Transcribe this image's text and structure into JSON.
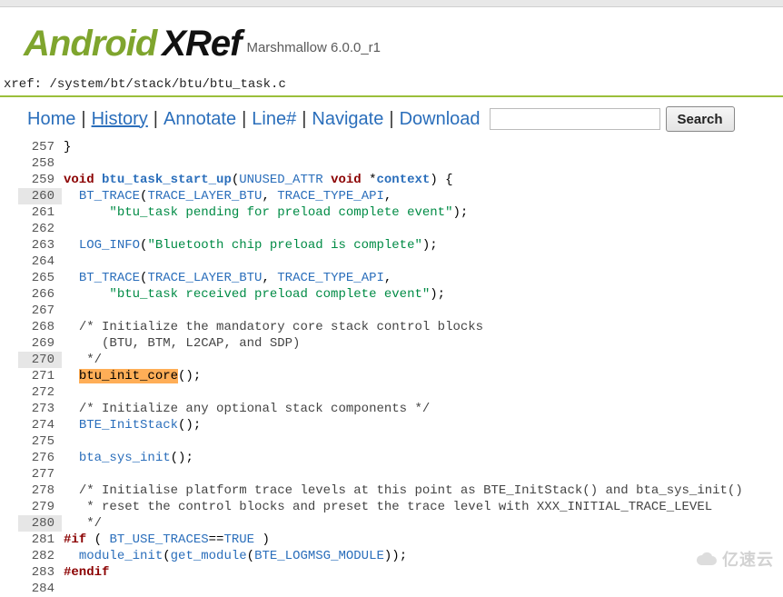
{
  "logo": {
    "part1": "Android",
    "part2": "XRef",
    "version": "Marshmallow 6.0.0_r1"
  },
  "path": {
    "prefix": "xref: ",
    "value": "/system/bt/stack/btu/btu_task.c"
  },
  "toolbar": {
    "home": "Home",
    "history": "History",
    "annotate": "Annotate",
    "line": "Line#",
    "navigate": "Navigate",
    "download": "Download",
    "search_placeholder": "",
    "search_btn": "Search"
  },
  "code": {
    "lines": [
      {
        "n": 257,
        "shade": false,
        "tokens": [
          {
            "t": "plain",
            "v": "}"
          }
        ]
      },
      {
        "n": 258,
        "shade": false,
        "tokens": []
      },
      {
        "n": 259,
        "shade": false,
        "tokens": [
          {
            "t": "kw",
            "v": "void"
          },
          {
            "t": "plain",
            "v": " "
          },
          {
            "t": "ident",
            "v": "btu_task_start_up"
          },
          {
            "t": "plain",
            "v": "("
          },
          {
            "t": "func",
            "v": "UNUSED_ATTR"
          },
          {
            "t": "plain",
            "v": " "
          },
          {
            "t": "kw",
            "v": "void"
          },
          {
            "t": "plain",
            "v": " *"
          },
          {
            "t": "ident",
            "v": "context"
          },
          {
            "t": "plain",
            "v": ") {"
          }
        ]
      },
      {
        "n": 260,
        "shade": true,
        "tokens": [
          {
            "t": "plain",
            "v": "  "
          },
          {
            "t": "func",
            "v": "BT_TRACE"
          },
          {
            "t": "plain",
            "v": "("
          },
          {
            "t": "func",
            "v": "TRACE_LAYER_BTU"
          },
          {
            "t": "plain",
            "v": ", "
          },
          {
            "t": "func",
            "v": "TRACE_TYPE_API"
          },
          {
            "t": "plain",
            "v": ","
          }
        ]
      },
      {
        "n": 261,
        "shade": false,
        "tokens": [
          {
            "t": "plain",
            "v": "      "
          },
          {
            "t": "str",
            "v": "\"btu_task pending for preload complete event\""
          },
          {
            "t": "plain",
            "v": ");"
          }
        ]
      },
      {
        "n": 262,
        "shade": false,
        "tokens": []
      },
      {
        "n": 263,
        "shade": false,
        "tokens": [
          {
            "t": "plain",
            "v": "  "
          },
          {
            "t": "func",
            "v": "LOG_INFO"
          },
          {
            "t": "plain",
            "v": "("
          },
          {
            "t": "str",
            "v": "\"Bluetooth chip preload is complete\""
          },
          {
            "t": "plain",
            "v": ");"
          }
        ]
      },
      {
        "n": 264,
        "shade": false,
        "tokens": []
      },
      {
        "n": 265,
        "shade": false,
        "tokens": [
          {
            "t": "plain",
            "v": "  "
          },
          {
            "t": "func",
            "v": "BT_TRACE"
          },
          {
            "t": "plain",
            "v": "("
          },
          {
            "t": "func",
            "v": "TRACE_LAYER_BTU"
          },
          {
            "t": "plain",
            "v": ", "
          },
          {
            "t": "func",
            "v": "TRACE_TYPE_API"
          },
          {
            "t": "plain",
            "v": ","
          }
        ]
      },
      {
        "n": 266,
        "shade": false,
        "tokens": [
          {
            "t": "plain",
            "v": "      "
          },
          {
            "t": "str",
            "v": "\"btu_task received preload complete event\""
          },
          {
            "t": "plain",
            "v": ");"
          }
        ]
      },
      {
        "n": 267,
        "shade": false,
        "tokens": []
      },
      {
        "n": 268,
        "shade": false,
        "tokens": [
          {
            "t": "plain",
            "v": "  "
          },
          {
            "t": "cmt",
            "v": "/* Initialize the mandatory core stack control blocks"
          }
        ]
      },
      {
        "n": 269,
        "shade": false,
        "tokens": [
          {
            "t": "plain",
            "v": "     "
          },
          {
            "t": "cmt",
            "v": "(BTU, BTM, L2CAP, and SDP)"
          }
        ]
      },
      {
        "n": 270,
        "shade": true,
        "tokens": [
          {
            "t": "plain",
            "v": "   "
          },
          {
            "t": "cmt",
            "v": "*/"
          }
        ]
      },
      {
        "n": 271,
        "shade": false,
        "tokens": [
          {
            "t": "plain",
            "v": "  "
          },
          {
            "t": "hl",
            "v": "btu_init_core"
          },
          {
            "t": "plain",
            "v": "();"
          }
        ]
      },
      {
        "n": 272,
        "shade": false,
        "tokens": []
      },
      {
        "n": 273,
        "shade": false,
        "tokens": [
          {
            "t": "plain",
            "v": "  "
          },
          {
            "t": "cmt",
            "v": "/* Initialize any optional stack components */"
          }
        ]
      },
      {
        "n": 274,
        "shade": false,
        "tokens": [
          {
            "t": "plain",
            "v": "  "
          },
          {
            "t": "func",
            "v": "BTE_InitStack"
          },
          {
            "t": "plain",
            "v": "();"
          }
        ]
      },
      {
        "n": 275,
        "shade": false,
        "tokens": []
      },
      {
        "n": 276,
        "shade": false,
        "tokens": [
          {
            "t": "plain",
            "v": "  "
          },
          {
            "t": "func",
            "v": "bta_sys_init"
          },
          {
            "t": "plain",
            "v": "();"
          }
        ]
      },
      {
        "n": 277,
        "shade": false,
        "tokens": []
      },
      {
        "n": 278,
        "shade": false,
        "tokens": [
          {
            "t": "plain",
            "v": "  "
          },
          {
            "t": "cmt",
            "v": "/* Initialise platform trace levels at this point as BTE_InitStack() and bta_sys_init()"
          }
        ]
      },
      {
        "n": 279,
        "shade": false,
        "tokens": [
          {
            "t": "plain",
            "v": "   "
          },
          {
            "t": "cmt",
            "v": "* reset the control blocks and preset the trace level with XXX_INITIAL_TRACE_LEVEL"
          }
        ]
      },
      {
        "n": 280,
        "shade": true,
        "tokens": [
          {
            "t": "plain",
            "v": "   "
          },
          {
            "t": "cmt",
            "v": "*/"
          }
        ]
      },
      {
        "n": 281,
        "shade": false,
        "tokens": [
          {
            "t": "pp",
            "v": "#if"
          },
          {
            "t": "plain",
            "v": " ( "
          },
          {
            "t": "func",
            "v": "BT_USE_TRACES"
          },
          {
            "t": "plain",
            "v": "=="
          },
          {
            "t": "func",
            "v": "TRUE"
          },
          {
            "t": "plain",
            "v": " )"
          }
        ]
      },
      {
        "n": 282,
        "shade": false,
        "tokens": [
          {
            "t": "plain",
            "v": "  "
          },
          {
            "t": "func",
            "v": "module_init"
          },
          {
            "t": "plain",
            "v": "("
          },
          {
            "t": "func",
            "v": "get_module"
          },
          {
            "t": "plain",
            "v": "("
          },
          {
            "t": "func",
            "v": "BTE_LOGMSG_MODULE"
          },
          {
            "t": "plain",
            "v": "));"
          }
        ]
      },
      {
        "n": 283,
        "shade": false,
        "tokens": [
          {
            "t": "pp",
            "v": "#endif"
          }
        ]
      },
      {
        "n": 284,
        "shade": false,
        "tokens": []
      }
    ]
  },
  "watermark": "亿速云"
}
